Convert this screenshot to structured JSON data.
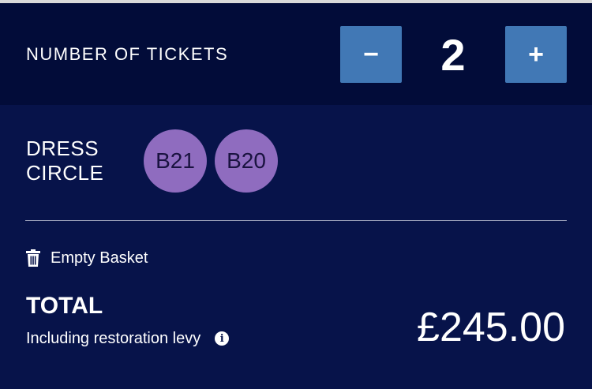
{
  "tickets": {
    "label": "NUMBER OF TICKETS",
    "decrement_symbol": "−",
    "increment_symbol": "+",
    "count": "2"
  },
  "section": {
    "name_line1": "DRESS",
    "name_line2": "CIRCLE",
    "seats": [
      "B21",
      "B20"
    ]
  },
  "basket": {
    "empty_label": "Empty Basket",
    "icon": "trash-icon"
  },
  "total": {
    "label": "TOTAL",
    "note": "Including restoration levy",
    "info_icon_glyph": "i",
    "amount": "£245.00"
  },
  "colors": {
    "header_bg": "#020c39",
    "main_bg": "#07134a",
    "stepper_button": "#4178b5",
    "seat_badge": "#8f6cbf"
  }
}
